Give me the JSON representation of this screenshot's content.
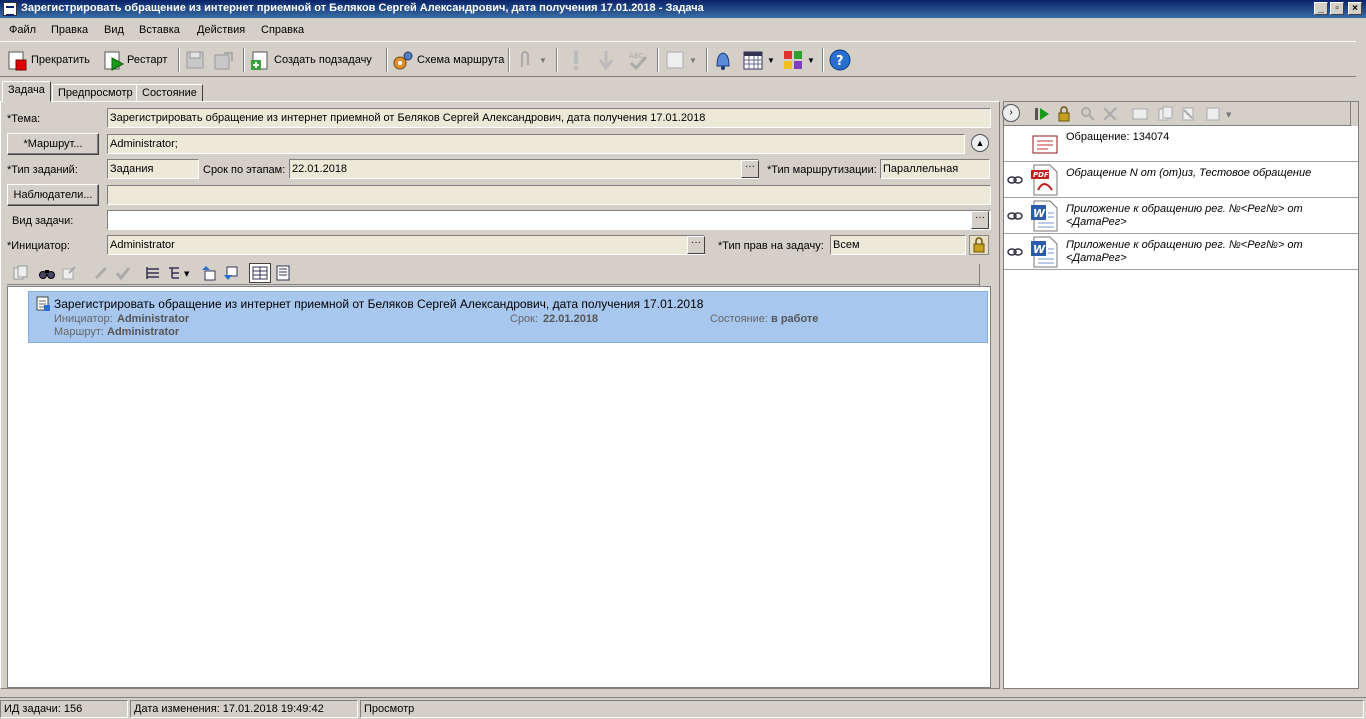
{
  "window": {
    "title": "Зарегистрировать обращение из интернет приемной от Беляков Сергей Александрович, дата получения 17.01.2018 - Задача"
  },
  "menu": [
    "Файл",
    "Правка",
    "Вид",
    "Вставка",
    "Действия",
    "Справка"
  ],
  "toolbar": {
    "stop": "Прекратить",
    "restart": "Рестарт",
    "create_subtask": "Создать подзадачу",
    "route_scheme": "Схема маршрута"
  },
  "tabs": [
    "Задача",
    "Предпросмотр",
    "Состояние"
  ],
  "form": {
    "subject_label": "*Тема:",
    "subject_value": "Зарегистрировать обращение из интернет приемной от Беляков Сергей Александрович, дата получения 17.01.2018",
    "route_button": "*Маршрут...",
    "route_value": "Administrator;",
    "task_type_label": "*Тип заданий:",
    "task_type_value": "Задания",
    "deadline_label": "Срок по этапам:",
    "deadline_value": "22.01.2018",
    "routing_type_label": "*Тип маршрутизации:",
    "routing_type_value": "Параллельная",
    "observers_button": "Наблюдатели...",
    "observers_value": "",
    "kind_label": "Вид задачи:",
    "kind_value": "",
    "initiator_label": "*Инициатор:",
    "initiator_value": "Administrator",
    "rights_label": "*Тип прав на задачу:",
    "rights_value": "Всем"
  },
  "tree": {
    "title": "Зарегистрировать обращение из интернет приемной от Беляков Сергей Александрович, дата получения 17.01.2018",
    "initiator_label": "Инициатор:",
    "initiator_value": "Administrator",
    "route_label": "Маршрут:",
    "route_value": "Administrator",
    "deadline_label": "Срок:",
    "deadline_value": "22.01.2018",
    "state_label": "Состояние:",
    "state_value": "в работе"
  },
  "attachments": [
    {
      "text": "Обращение: 134074",
      "icon": "document-icon"
    },
    {
      "text": "Обращение N от (от)из, Тестовое обращение",
      "icon": "pdf-icon"
    },
    {
      "line1": "Приложение к обращению рег. №<Рег№> от",
      "line2": "<ДатаРег>",
      "icon": "word-icon"
    },
    {
      "line1": "Приложение к обращению рег. №<Рег№> от",
      "line2": "<ДатаРег>",
      "icon": "word-icon"
    }
  ],
  "status": {
    "task_id": "ИД задачи: 156",
    "modified": "Дата изменения: 17.01.2018 19:49:42",
    "mode": "Просмотр"
  }
}
